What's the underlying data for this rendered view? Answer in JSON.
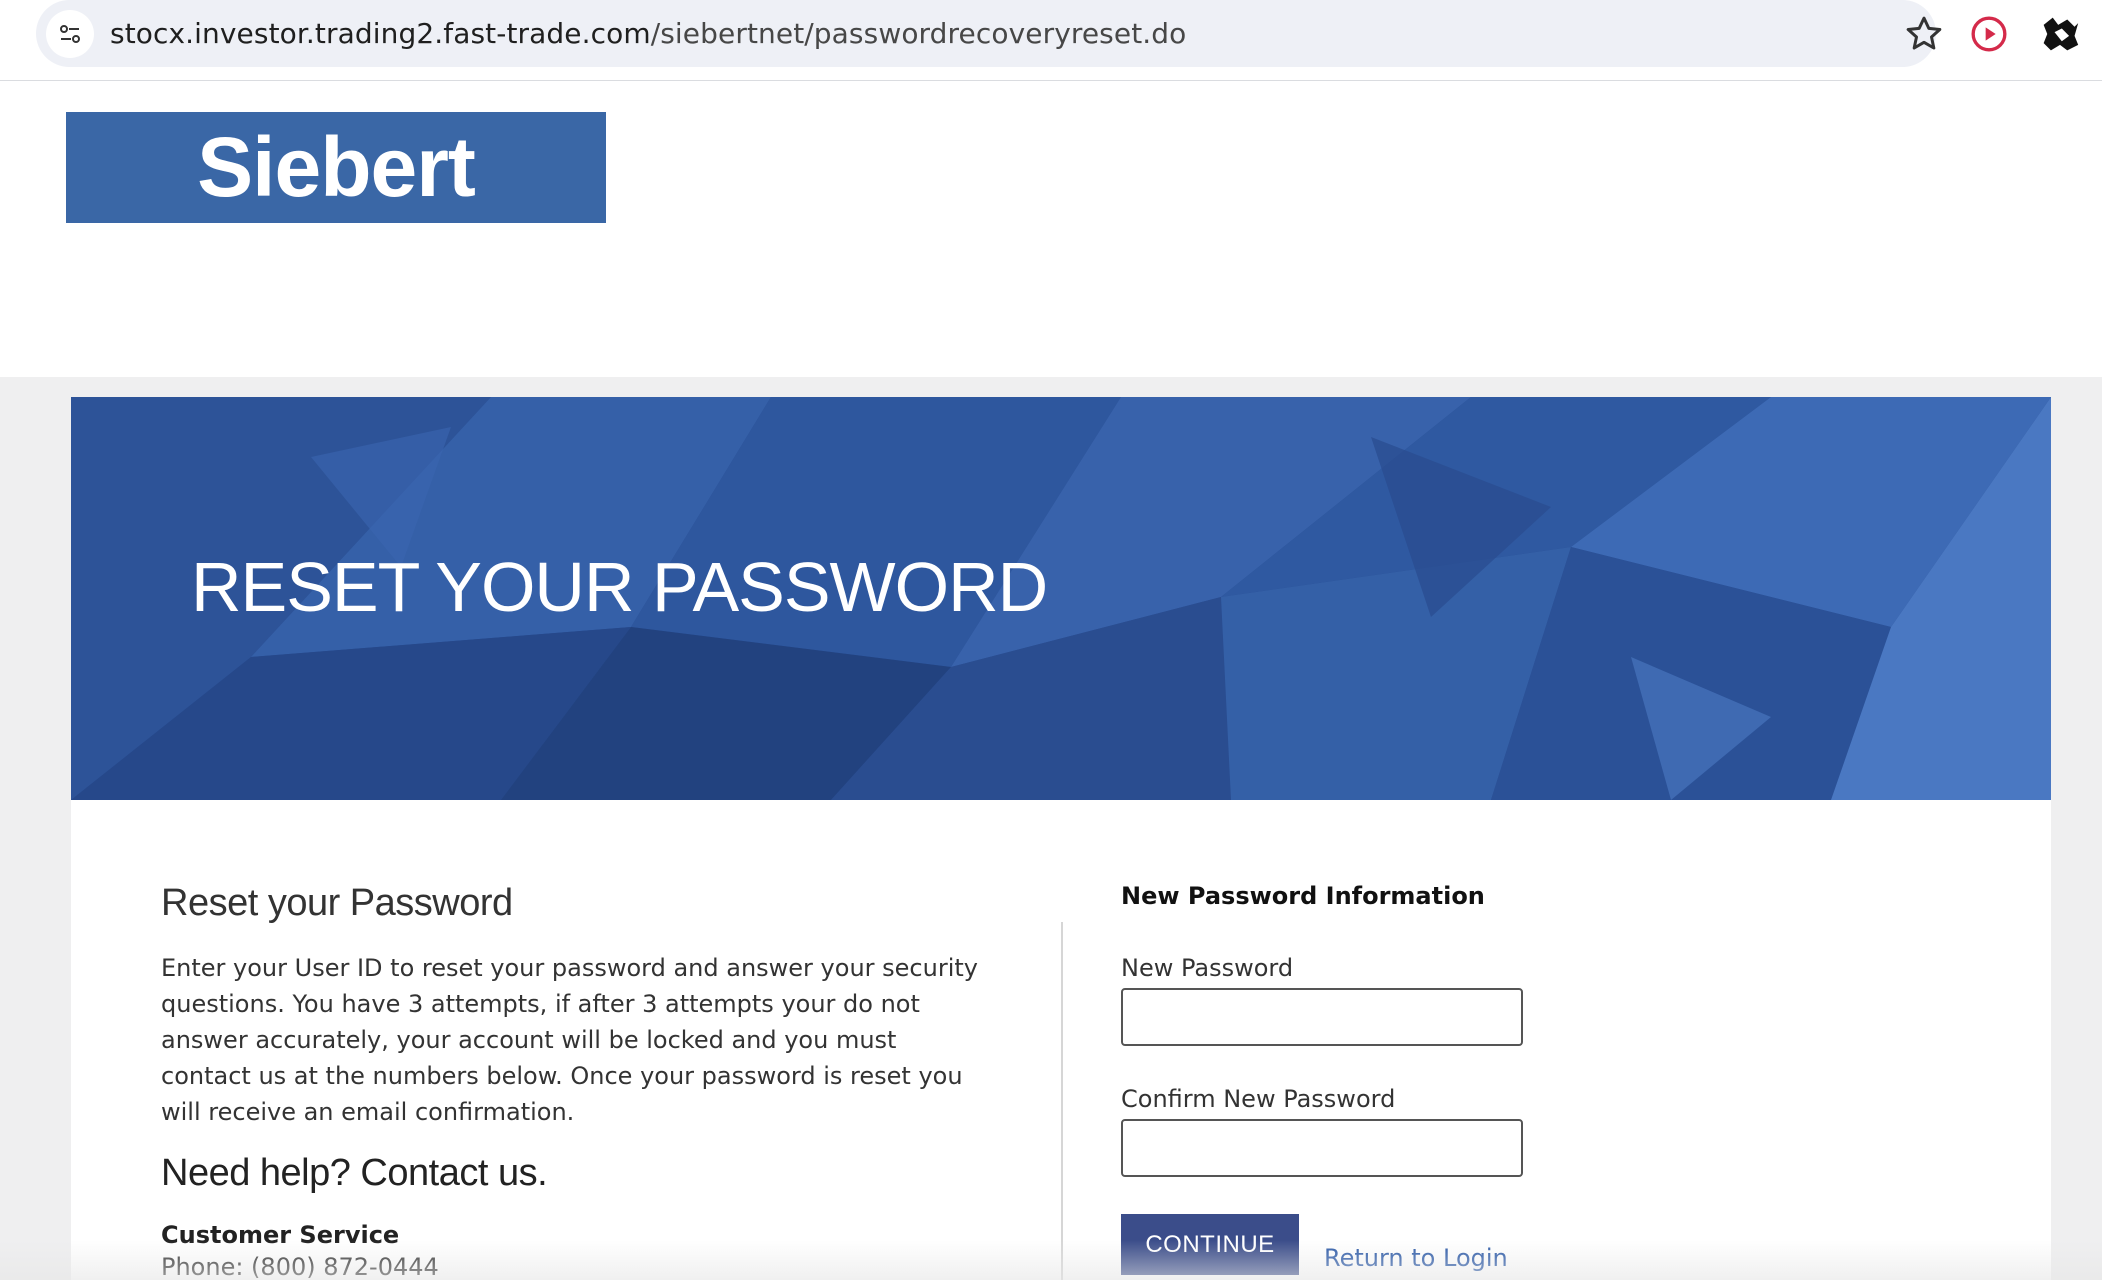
{
  "browser": {
    "url_host": "stocx.investor.trading2.fast-trade.com",
    "url_path": "/siebertnet/passwordrecoveryreset.do",
    "icons": [
      "site-info-icon",
      "bookmark-star-icon",
      "record-extension-icon",
      "extension-icon"
    ]
  },
  "header": {
    "logo_text": "Siebert"
  },
  "banner": {
    "title": "RESET YOUR PASSWORD"
  },
  "info": {
    "heading": "Reset your Password",
    "intro": "Enter your User ID to reset your password and answer your security questions. You have 3 attempts, if after 3 attempts your do not answer accurately, your account will be locked and you must contact us at the numbers below. Once your password is reset you will receive an email confirmation.",
    "help_heading": "Need help? Contact us.",
    "customer_service_label": "Customer Service",
    "customer_service_phone": "Phone: (800) 872-0444"
  },
  "form": {
    "title": "New Password Information",
    "new_password_label": "New Password",
    "new_password_value": "",
    "confirm_password_label": "Confirm New Password",
    "confirm_password_value": "",
    "continue_label": "CONTINUE",
    "return_link": "Return to Login"
  },
  "colors": {
    "brand_blue": "#3a67a6",
    "banner_blue": "#2a4e92",
    "button_navy": "#3b4d8a",
    "link_blue": "#2b59a7"
  }
}
